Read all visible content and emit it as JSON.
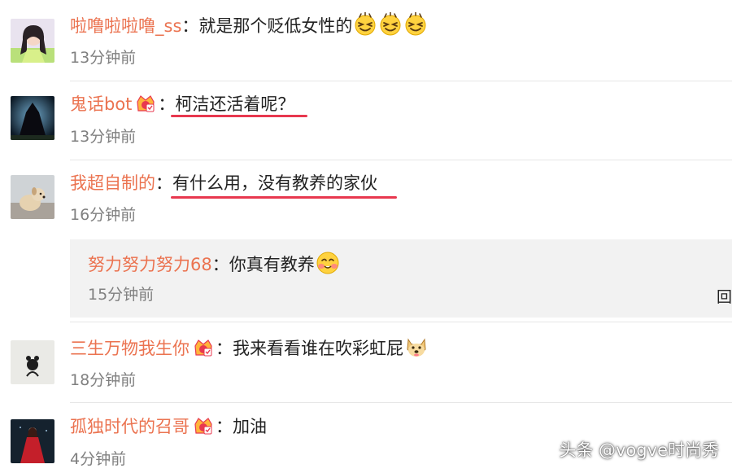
{
  "comments": [
    {
      "username": "啦噜啦啦噜_ss",
      "colon": "：",
      "text": "就是那个贬低女性的",
      "time": "13分钟前"
    },
    {
      "username": "鬼话bot",
      "colon": "：",
      "text": "柯洁还活着呢？",
      "time": "13分钟前"
    },
    {
      "username": "我超自制的",
      "colon": "：",
      "text": "有什么用，没有教养的家伙",
      "time": "16分钟前"
    },
    {
      "username": "三生万物我生你",
      "colon": "：",
      "text": "我来看看谁在吹彩虹屁",
      "time": "18分钟前"
    },
    {
      "username": "孤独时代的召哥",
      "colon": "：",
      "text": "加油",
      "time": "4分钟前"
    }
  ],
  "reply": {
    "username": "努力努力努力68",
    "colon": "：",
    "text": "你真有教养",
    "time": "15分钟前",
    "reply_label": "回"
  },
  "watermark": "头条 @vogve时尚秀",
  "colors": {
    "username": "#eb7350",
    "underline": "#e8384f",
    "time": "#808080",
    "reply_bg": "#f2f2f2"
  },
  "icons": [
    "avatar-girl",
    "avatar-cloaked-figure",
    "avatar-dog",
    "avatar-cartoon-figure",
    "avatar-woman-red-dress",
    "squint-laugh-emoji",
    "shy-smile-emoji",
    "doge-emoji",
    "vip-crown-badge"
  ]
}
